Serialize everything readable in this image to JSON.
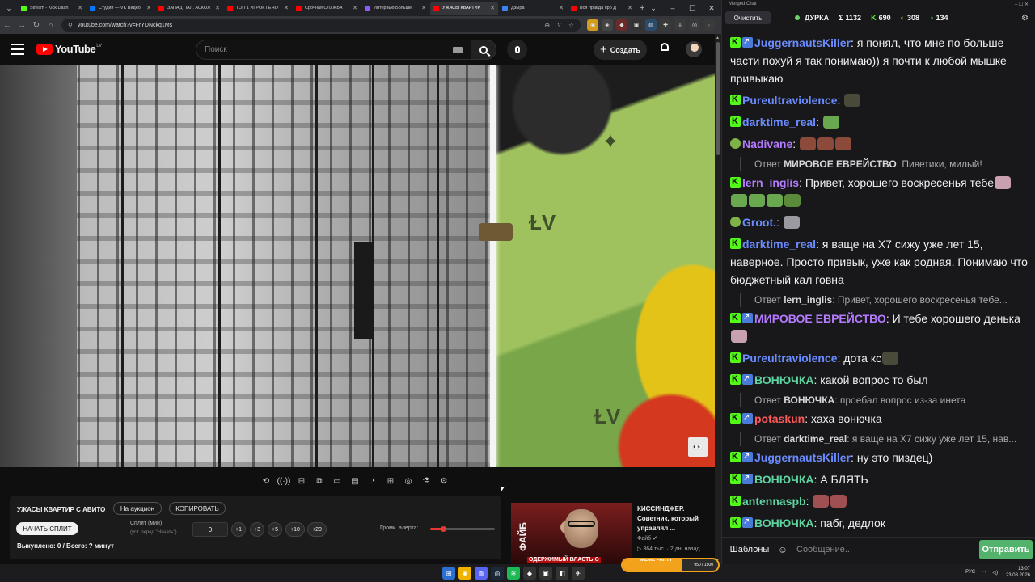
{
  "browser": {
    "tabs": [
      {
        "title": "Stream - Kick Dash",
        "color": "#53fc18"
      },
      {
        "title": "Студия — VK Видео",
        "color": "#0077ff"
      },
      {
        "title": "ЗАПАД ПАЛ. АСКОЛ",
        "color": "#ff0000"
      },
      {
        "title": "ТОП 1 ИГРОК ГЕНО",
        "color": "#ff0000"
      },
      {
        "title": "Срочная СЛУЖБА",
        "color": "#ff0000"
      },
      {
        "title": "Интервью Больше",
        "color": "#8b5cf6"
      },
      {
        "title": "УЖАСЫ КВАРТИР",
        "color": "#ff0000",
        "active": true
      },
      {
        "title": "Дзыра",
        "color": "#3b82f6"
      },
      {
        "title": "Вся правда про Д",
        "color": "#ff0000"
      }
    ],
    "url": "youtube.com/watch?v=FrYDNckq1Ms"
  },
  "youtube": {
    "logo_text": "YouTube",
    "logo_country": "LV",
    "search_placeholder": "Поиск",
    "create_label": "Создать"
  },
  "player_tools": [
    "⟲",
    "((·))",
    "⊟",
    "⧉",
    "▭",
    "▤",
    "◔",
    "⊞",
    "◎",
    "⚗",
    "⚙"
  ],
  "auction": {
    "title": "УЖАСЫ КВАРТИР С АВИТО",
    "on_auction": "На аукцион",
    "copy": "КОПИРОВАТЬ",
    "start_split": "НАЧАТЬ СПЛИТ",
    "split_label": "Сплит (мин):",
    "split_hint": "(уст. перед \"Начать\")",
    "split_value": "0",
    "steps": [
      "+1",
      "+3",
      "+5",
      "+10",
      "+20"
    ],
    "volume_label": "Громк. алерта:",
    "volume_level": 0.2,
    "status": "Выкуплено: 0 / Всего: ? минут"
  },
  "related": {
    "title": "КИССИНДЖЕР. Советник, который управлял ...",
    "channel": "Файб",
    "meta": "364 тыс. · 2 дн. назад",
    "thumb_vertical": "ФАЙБ",
    "thumb_caption": "ОДЕРЖИМЫЙ ВЛАСТЬЮ"
  },
  "chat": {
    "window_title": "Merged Chat",
    "clear_label": "Очистить",
    "channel": "ДУРКА",
    "stats": [
      {
        "icon": "Σ",
        "value": "1132"
      },
      {
        "icon": "K",
        "value": "690"
      },
      {
        "icon": "◐",
        "value": "308"
      },
      {
        "icon": "◑",
        "value": "134"
      }
    ],
    "messages": [
      {
        "badges": [
          "kick",
          "sub"
        ],
        "nick": "JuggernautsKiller",
        "color": "#6b8cff",
        "text": "я понял, что мне по больше части похуй я так понимаю)) я почти к любой мышке привыкаю"
      },
      {
        "badges": [
          "kick"
        ],
        "nick": "Pureultraviolence",
        "color": "#6b8cff",
        "text": "",
        "emotes": [
          "#4a4a3a"
        ]
      },
      {
        "badges": [
          "kick"
        ],
        "nick": "darktime_real",
        "color": "#6b8cff",
        "text": "",
        "emotes": [
          "#6aa84f"
        ]
      },
      {
        "badges": [
          "pepe"
        ],
        "nick": "Nadivane",
        "color": "#b57bff",
        "text": "",
        "emotes": [
          "#8b4a3a",
          "#8b4a3a",
          "#8b4a3a"
        ],
        "reply": {
          "to": "МИРОВОЕ ЕВРЕЙСТВО",
          "text": "Пиветики, милый!"
        }
      },
      {
        "badges": [
          "kick"
        ],
        "nick": "lern_inglis",
        "color": "#b57bff",
        "text": "Привет, хорошего воскресенья тебе",
        "emotes": [
          "#c9a0b0",
          "#6aa84f",
          "#6aa84f",
          "#6aa84f",
          "#5a8a3a"
        ]
      },
      {
        "badges": [
          "pepe"
        ],
        "nick": "Groot.",
        "color": "#6b8cff",
        "text": "",
        "emotes": [
          "#9a9aa0"
        ]
      },
      {
        "badges": [
          "kick"
        ],
        "nick": "darktime_real",
        "color": "#6b8cff",
        "text": "я ваще на X7 сижу уже лет 15, наверное. Просто привык, уже как родная. Понимаю что бюджетный кал говна",
        "reply": {
          "to": "lern_inglis",
          "text": "Привет, хорошего воскресенья тебе..."
        }
      },
      {
        "badges": [
          "kick",
          "sub"
        ],
        "nick": "МИРОВОЕ ЕВРЕЙСТВО",
        "color": "#b57bff",
        "text": "И тебе хорошего денька",
        "emotes": [
          "#c9a0b0"
        ]
      },
      {
        "badges": [
          "kick"
        ],
        "nick": "Pureultraviolence",
        "color": "#6b8cff",
        "text": "дота кс",
        "emotes": [
          "#4a4a3a"
        ]
      },
      {
        "badges": [
          "kick",
          "sub"
        ],
        "nick": "ВОНЮЧКА",
        "color": "#5fd4a0",
        "text": "какой вопрос то был",
        "reply": {
          "to": "ВОНЮЧКА",
          "text": "проебал вопрос из-за инета"
        }
      },
      {
        "badges": [
          "kick",
          "sub"
        ],
        "nick": "potaskun",
        "color": "#ff5a5a",
        "text": "хаха вонючка",
        "reply": {
          "to": "darktime_real",
          "text": "я ваще на X7 сижу уже лет 15, нав..."
        }
      },
      {
        "badges": [
          "kick",
          "sub"
        ],
        "nick": "JuggernautsKiller",
        "color": "#6b8cff",
        "text": "ну это пиздец)"
      },
      {
        "badges": [
          "kick",
          "sub"
        ],
        "nick": "ВОНЮЧКА",
        "color": "#5fd4a0",
        "text": "А БЛЯТЬ"
      },
      {
        "badges": [
          "kick"
        ],
        "nick": "antennaspb",
        "color": "#5fd4a0",
        "text": "",
        "emotes": [
          "#a05050",
          "#a05050"
        ]
      },
      {
        "badges": [
          "kick",
          "sub"
        ],
        "nick": "ВОНЮЧКА",
        "color": "#5fd4a0",
        "text": "пабг, дедлок"
      }
    ],
    "reply_prefix": "Ответ",
    "templates_label": "Шаблоны",
    "input_placeholder": "Сообщение...",
    "send_label": "Отправить"
  },
  "taskbar": {
    "meme_label": "MEME PARTY",
    "meme_count": "950 / 1500",
    "meme_level": 0.63,
    "lang": "РУС",
    "time": "13:07",
    "date": "23.08.2026"
  },
  "colors": {
    "accent_kick": "#53fc18",
    "send_button": "#53b26b",
    "yt_red": "#ff0000"
  }
}
